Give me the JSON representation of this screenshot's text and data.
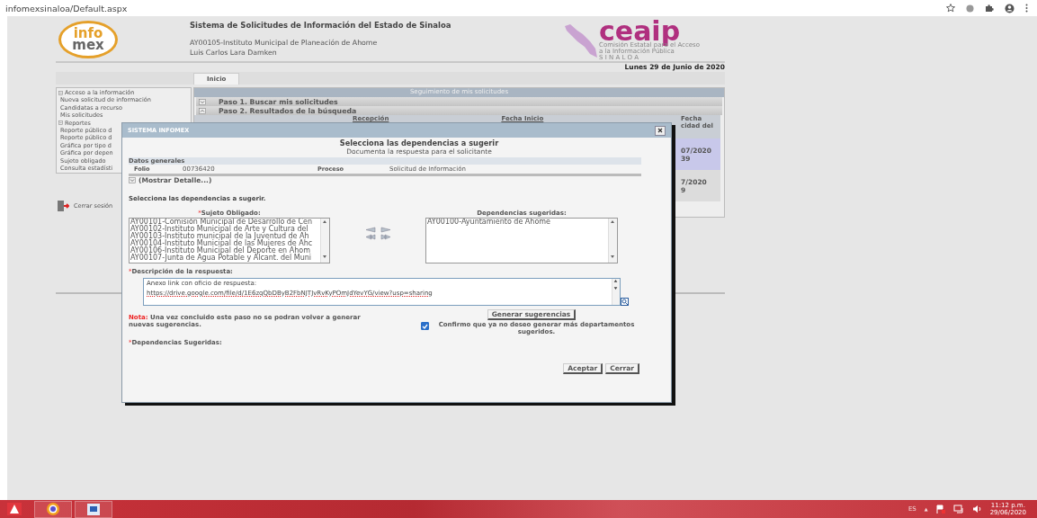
{
  "browser": {
    "url": "infomexsinaloa/Default.aspx"
  },
  "header": {
    "logo_top": "info",
    "logo_bottom": "mex",
    "title": "Sistema de Solicitudes de Información del Estado de Sinaloa",
    "institution": "AY00105-Instituto Municipal de Planeación de Ahome",
    "user": "Luis Carlos Lara Damken",
    "ceaip_name": "ceaip",
    "ceaip_subtitle": "Comisión Estatal para el Acceso a la Información Pública",
    "ceaip_state": "S I N A L O A",
    "date": "Lunes 29 de Junio de 2020"
  },
  "tabs": [
    {
      "label": "Inicio",
      "selected": true
    }
  ],
  "sidebar": {
    "items": [
      {
        "label": "Acceso a la información",
        "kind": "group"
      },
      {
        "label": "Nueva solicitud de información",
        "kind": "item"
      },
      {
        "label": "Candidatas a recurso",
        "kind": "item"
      },
      {
        "label": "Mis solicitudes",
        "kind": "item"
      },
      {
        "label": "Reportes",
        "kind": "group"
      },
      {
        "label": "Reporte público d",
        "kind": "item"
      },
      {
        "label": "Reporte público d",
        "kind": "item"
      },
      {
        "label": "Gráfica por tipo d",
        "kind": "item"
      },
      {
        "label": "Gráfica por depen",
        "kind": "item"
      },
      {
        "label": "Sujeto obligado",
        "kind": "item"
      },
      {
        "label": "Consulta estadísti",
        "kind": "item"
      }
    ],
    "logout": "Cerrar sesión"
  },
  "panel": {
    "title": "Seguimiento de mis solicitudes",
    "steps": [
      {
        "label": "Paso 1. Buscar mis solicitudes",
        "expanded": false
      },
      {
        "label": "Paso 2. Resultados de la búsqueda",
        "expanded": true
      }
    ],
    "columns": [
      "Recepción",
      "Fecha Inicio"
    ],
    "last_column": {
      "header": [
        "Fecha",
        "cidad del"
      ],
      "rows": [
        {
          "cells": [
            "07/2020",
            "39"
          ],
          "selected": true
        },
        {
          "cells": [
            "7/2020",
            "9"
          ],
          "selected": false
        }
      ]
    }
  },
  "modal": {
    "title": "SISTEMA INFOMEX",
    "heading": "Selecciona las dependencias a sugerir",
    "subheading": "Documenta la respuesta para el solicitante",
    "general": {
      "title": "Datos generales",
      "folio_label": "Folio",
      "folio": "00736420",
      "process_label": "Proceso",
      "process": "Solicitud de Información",
      "details": "(Mostrar Detalle...)"
    },
    "instruction": "Selecciona las dependencias a sugerir.",
    "required_mark": "*",
    "source_list": {
      "label": "Sujeto Obligado:",
      "options": [
        "AY00101-Comisión Municipal de Desarrollo de Cen",
        "AY00102-Instituto Municipal de Arte y Cultura del",
        "AY00103-Instituto municipal de la Juventud de Ah",
        "AY00104-Instituto Municipal de las Mujeres de Ahc",
        "AY00106-Instituto Municipal del Deporte en Ahom",
        "AY00107-Junta de Agua Potable y Alcant. del Muni"
      ]
    },
    "target_list": {
      "label": "Dependencias sugeridas:",
      "options": [
        "AY00100-Ayuntamiento de Ahome"
      ]
    },
    "description": {
      "label": "Descripción de la respuesta:",
      "line1": "Anexo link con oficio de respuesta:",
      "line2": "https://drive.google.com/file/d/1E6zqQbDByB2FbNJTJvRvKyPOmJdYevYG/view?usp=sharing"
    },
    "generate_button": "Generar sugerencias",
    "note_label": "Nota:",
    "note": "Una vez concluido este paso no se podran volver a generar nuevas sugerencias.",
    "confirm": {
      "label": "Confirmo que ya no deseo generar más departamentos sugeridos.",
      "checked": true
    },
    "suggested_label": "Dependencias Sugeridas:",
    "buttons": [
      "Aceptar",
      "Cerrar"
    ]
  },
  "taskbar": {
    "language": "ES",
    "tray_arrow": "▲",
    "time": "11:12 p.m.",
    "date": "29/06/2020"
  }
}
